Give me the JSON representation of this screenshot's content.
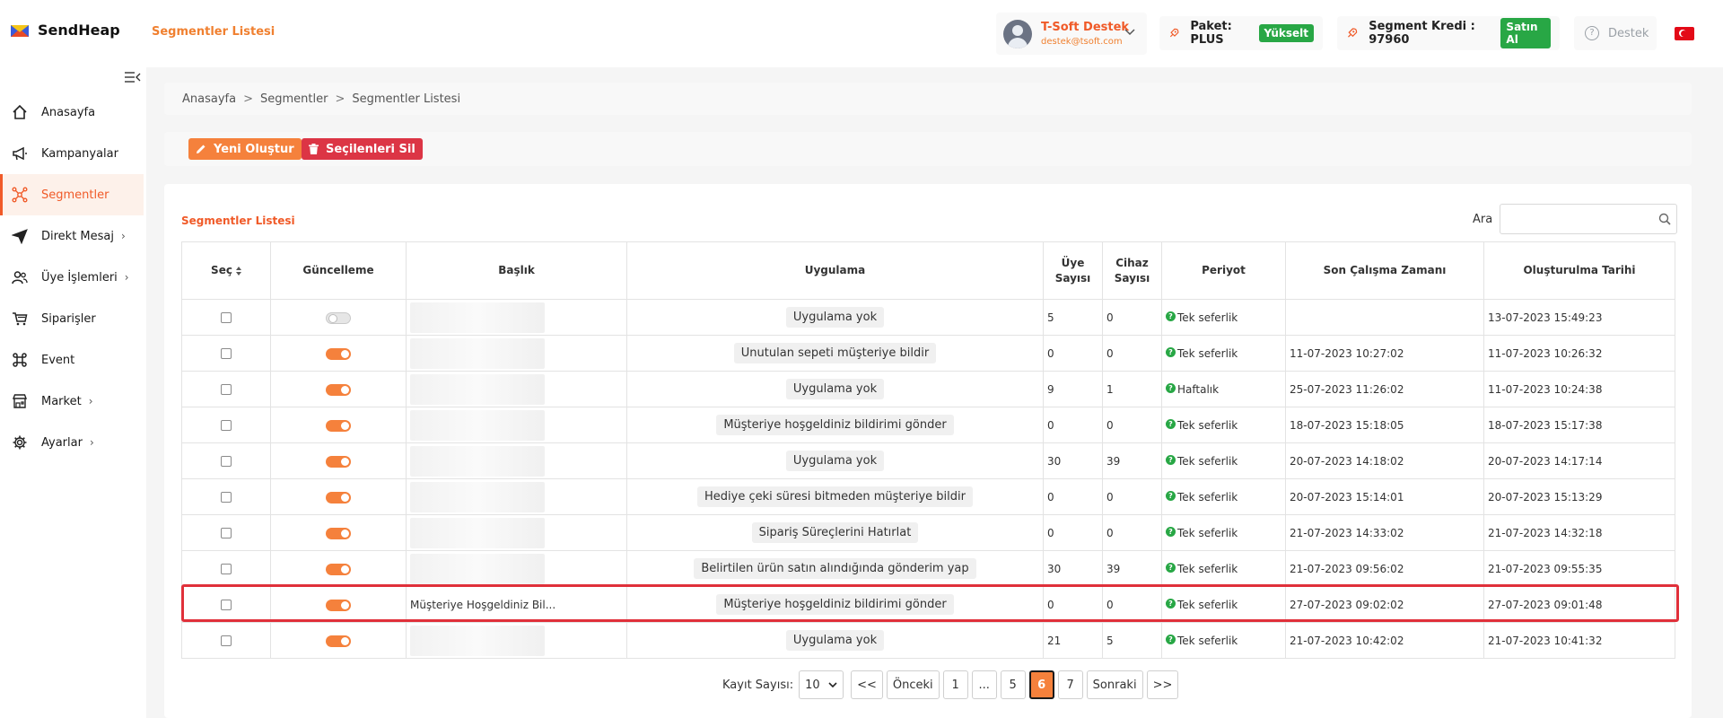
{
  "header": {
    "logo_text": "SendHeap",
    "page_title": "Segmentler Listesi",
    "user_name": "T-Soft Destek",
    "user_email": "destek@tsoft.com",
    "package_label": "Paket: PLUS",
    "upgrade_label": "Yükselt",
    "credit_label": "Segment Kredi : 97960",
    "buy_label": "Satın Al",
    "support_label": "Destek"
  },
  "sidebar": {
    "items": [
      {
        "label": "Anasayfa",
        "icon": "home-icon"
      },
      {
        "label": "Kampanyalar",
        "icon": "megaphone-icon"
      },
      {
        "label": "Segmentler",
        "icon": "segment-icon",
        "active": true
      },
      {
        "label": "Direkt Mesaj",
        "icon": "send-icon"
      },
      {
        "label": "Üye İşlemleri",
        "icon": "users-icon"
      },
      {
        "label": "Siparişler",
        "icon": "cart-icon"
      },
      {
        "label": "Event",
        "icon": "command-icon"
      },
      {
        "label": "Market",
        "icon": "store-icon"
      },
      {
        "label": "Ayarlar",
        "icon": "gear-icon"
      }
    ]
  },
  "breadcrumb": [
    "Anasayfa",
    "Segmentler",
    "Segmentler Listesi"
  ],
  "toolbar": {
    "create_label": "Yeni Oluştur",
    "delete_label": "Seçilenleri Sil"
  },
  "card": {
    "title": "Segmentler Listesi",
    "search_label": "Ara",
    "search_value": ""
  },
  "table": {
    "headers": [
      "Seç",
      "Güncelleme",
      "Başlık",
      "Uygulama",
      "Üye Sayısı",
      "Cihaz Sayısı",
      "Periyot",
      "Son Çalışma Zamanı",
      "Oluşturulma Tarihi"
    ],
    "rows": [
      {
        "toggle": false,
        "title": "",
        "app": "Uygulama yok",
        "members": "5",
        "devices": "0",
        "period": "Tek seferlik",
        "last_run": "",
        "created": "13-07-2023 15:49:23"
      },
      {
        "toggle": true,
        "title": "",
        "app": "Unutulan sepeti müşteriye bildir",
        "members": "0",
        "devices": "0",
        "period": "Tek seferlik",
        "last_run": "11-07-2023 10:27:02",
        "created": "11-07-2023 10:26:32"
      },
      {
        "toggle": true,
        "title": "",
        "app": "Uygulama yok",
        "members": "9",
        "devices": "1",
        "period": "Haftalık",
        "last_run": "25-07-2023 11:26:02",
        "created": "11-07-2023 10:24:38"
      },
      {
        "toggle": true,
        "title": "",
        "app": "Müşteriye hoşgeldiniz bildirimi gönder",
        "members": "0",
        "devices": "0",
        "period": "Tek seferlik",
        "last_run": "18-07-2023 15:18:05",
        "created": "18-07-2023 15:17:38"
      },
      {
        "toggle": true,
        "title": "",
        "app": "Uygulama yok",
        "members": "30",
        "devices": "39",
        "period": "Tek seferlik",
        "last_run": "20-07-2023 14:18:02",
        "created": "20-07-2023 14:17:14"
      },
      {
        "toggle": true,
        "title": "",
        "app": "Hediye çeki süresi bitmeden müşteriye bildir",
        "members": "0",
        "devices": "0",
        "period": "Tek seferlik",
        "last_run": "20-07-2023 15:14:01",
        "created": "20-07-2023 15:13:29"
      },
      {
        "toggle": true,
        "title": "",
        "app": "Sipariş Süreçlerini Hatırlat",
        "members": "0",
        "devices": "0",
        "period": "Tek seferlik",
        "last_run": "21-07-2023 14:33:02",
        "created": "21-07-2023 14:32:18"
      },
      {
        "toggle": true,
        "title": "",
        "app": "Belirtilen ürün satın alındığında gönderim yap",
        "members": "30",
        "devices": "39",
        "period": "Tek seferlik",
        "last_run": "21-07-2023 09:56:02",
        "created": "21-07-2023 09:55:35"
      },
      {
        "toggle": true,
        "title": "Müşteriye Hoşgeldiniz Bil...",
        "app": "Müşteriye hoşgeldiniz bildirimi gönder",
        "members": "0",
        "devices": "0",
        "period": "Tek seferlik",
        "last_run": "27-07-2023 09:02:02",
        "created": "27-07-2023 09:01:48",
        "highlighted": true
      },
      {
        "toggle": true,
        "title": "",
        "app": "Uygulama yok",
        "members": "21",
        "devices": "5",
        "period": "Tek seferlik",
        "last_run": "21-07-2023 10:42:02",
        "created": "21-07-2023 10:41:32"
      }
    ]
  },
  "pagination": {
    "records_label": "Kayıt Sayısı:",
    "page_size": "10",
    "first": "<<",
    "prev": "Önceki",
    "pages": [
      "1",
      "...",
      "5",
      "6",
      "7"
    ],
    "active_page": "6",
    "next": "Sonraki",
    "last": ">>"
  },
  "colors": {
    "accent": "#f05a28",
    "orange_button": "#f5813c",
    "red_button": "#dc3545",
    "green": "#28a745",
    "highlight_border": "#e0303a"
  }
}
